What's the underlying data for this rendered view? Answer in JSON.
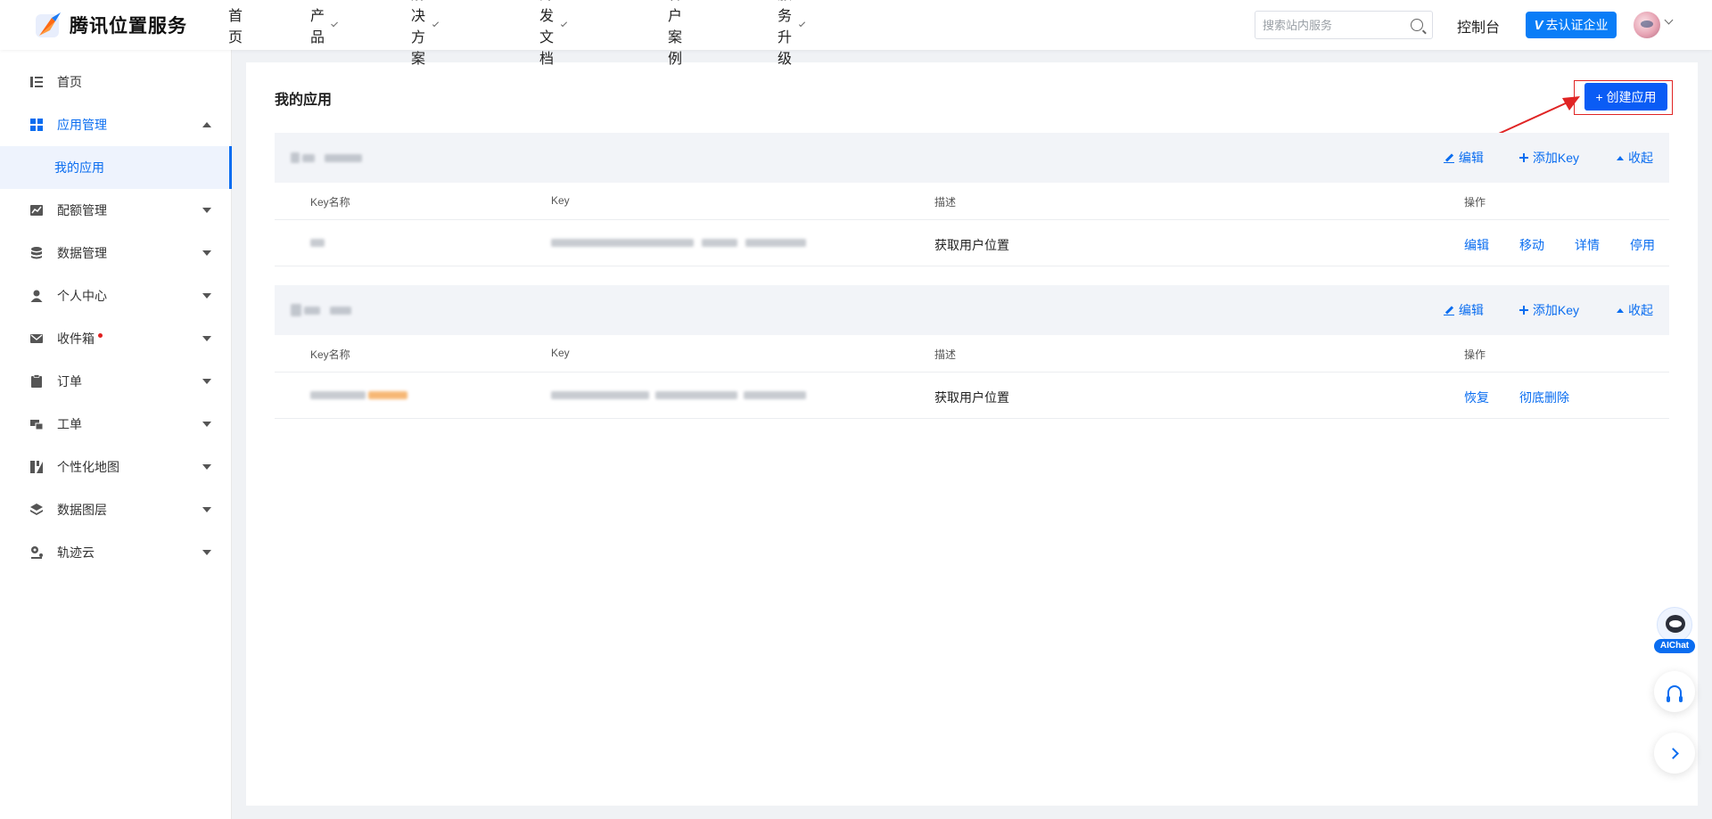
{
  "brand": {
    "name": "腾讯位置服务"
  },
  "nav": [
    {
      "label": "首页",
      "has_menu": false
    },
    {
      "label": "产品",
      "has_menu": true
    },
    {
      "label": "解决方案",
      "has_menu": true
    },
    {
      "label": "开发文档",
      "has_menu": true
    },
    {
      "label": "客户案例",
      "has_menu": false
    },
    {
      "label": "服务升级",
      "has_menu": true
    }
  ],
  "search": {
    "placeholder": "搜索站内服务"
  },
  "header": {
    "console_label": "控制台",
    "verify_prefix": "V",
    "verify_label": "去认证企业"
  },
  "sidebar": {
    "items": [
      {
        "label": "首页",
        "icon": "list-icon"
      },
      {
        "label": "应用管理",
        "icon": "grid-icon",
        "expanded": true
      },
      {
        "label": "配额管理",
        "icon": "chart-icon"
      },
      {
        "label": "数据管理",
        "icon": "database-icon"
      },
      {
        "label": "个人中心",
        "icon": "user-icon"
      },
      {
        "label": "收件箱",
        "icon": "mail-icon",
        "badge_dot": true
      },
      {
        "label": "订单",
        "icon": "clipboard-icon"
      },
      {
        "label": "工单",
        "icon": "ticket-icon"
      },
      {
        "label": "个性化地图",
        "icon": "map-style-icon"
      },
      {
        "label": "数据图层",
        "icon": "layers-icon"
      },
      {
        "label": "轨迹云",
        "icon": "track-icon"
      }
    ],
    "sub_item": {
      "label": "我的应用"
    }
  },
  "main": {
    "title": "我的应用",
    "create_label": "+ 创建应用",
    "columns": {
      "key_name": "Key名称",
      "key": "Key",
      "desc": "描述",
      "ops": "操作"
    },
    "head_actions": {
      "edit": "编辑",
      "add_key": "添加Key",
      "collapse": "收起"
    },
    "apps": [
      {
        "rows": [
          {
            "desc": "获取用户位置",
            "ops": [
              "编辑",
              "移动",
              "详情",
              "停用"
            ]
          }
        ]
      },
      {
        "rows": [
          {
            "desc": "获取用户位置",
            "ops": [
              "恢复",
              "彻底删除"
            ]
          }
        ]
      }
    ]
  },
  "floating": {
    "ai_label": "AIChat"
  },
  "colors": {
    "accent": "#0a6df0",
    "primary_button": "#0a5cf5",
    "annotation_red": "#e02424"
  }
}
